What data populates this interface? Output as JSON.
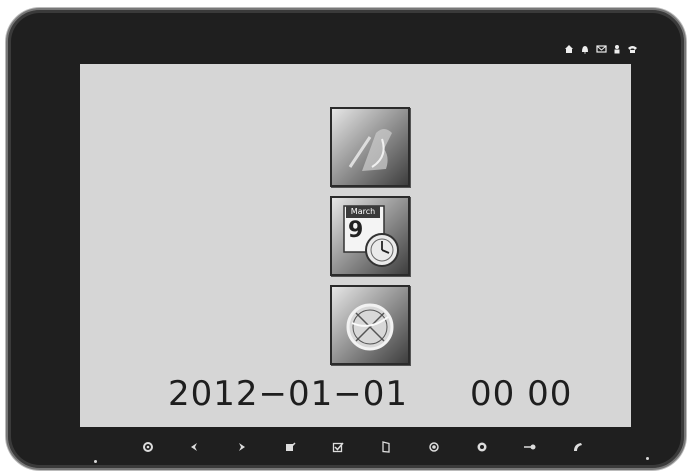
{
  "status_icons": [
    "home-icon",
    "bell-icon",
    "mail-icon",
    "user-icon",
    "phone-icon"
  ],
  "menu": [
    {
      "icon": "intercom-icon"
    },
    {
      "icon": "calendar-clock-icon",
      "calendar_month": "March",
      "calendar_day": "9"
    },
    {
      "icon": "ban-icon"
    }
  ],
  "datetime": {
    "date": "2012−01−01",
    "time": "00 00"
  },
  "buttons": [
    {
      "icon": "settings-icon"
    },
    {
      "icon": "left-arrow-icon"
    },
    {
      "icon": "right-arrow-icon"
    },
    {
      "icon": "edit-icon"
    },
    {
      "icon": "confirm-icon"
    },
    {
      "icon": "door-icon"
    },
    {
      "icon": "record-icon"
    },
    {
      "icon": "monitor-icon"
    },
    {
      "icon": "key-icon"
    },
    {
      "icon": "handset-icon"
    }
  ]
}
